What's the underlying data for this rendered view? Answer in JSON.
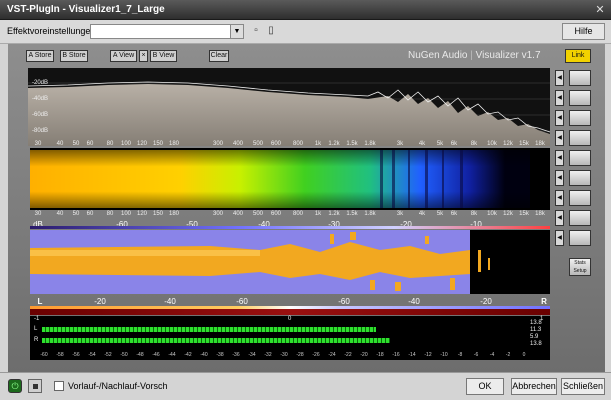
{
  "window": {
    "title": "VST-PlugIn - Visualizer1_7_Large",
    "close_symbol": "✕"
  },
  "presetbar": {
    "label": "Effektvoreinstellungen:",
    "preset_value": "",
    "help_label": "Hilfe"
  },
  "plugin": {
    "buttons": {
      "a_store": "A Store",
      "b_store": "B Store",
      "a_view": "A View",
      "x": "×",
      "b_view": "B View",
      "clear": "Clear",
      "link": "Link"
    },
    "brand": {
      "company": "NuGen Audio",
      "separator": "|",
      "product": "Visualizer v1.7"
    },
    "spectrum": {
      "db_labels": [
        "-20dB",
        "-40dB",
        "-60dB",
        "-80dB"
      ],
      "freq_labels": [
        "30",
        "40",
        "50",
        "60",
        "80",
        "100",
        "120",
        "150",
        "180",
        "300",
        "400",
        "500",
        "600",
        "800",
        "1k",
        "1.2k",
        "1.5k",
        "1.8k",
        "3k",
        "4k",
        "5k",
        "6k",
        "8k",
        "10k",
        "12k",
        "15k",
        "18k"
      ]
    },
    "spectrogram": {
      "freq_labels": [
        "30",
        "40",
        "50",
        "60",
        "80",
        "100",
        "120",
        "150",
        "180",
        "300",
        "400",
        "500",
        "600",
        "800",
        "1k",
        "1.2k",
        "1.5k",
        "1.8k",
        "3k",
        "4k",
        "5k",
        "6k",
        "8k",
        "10k",
        "12k",
        "15k",
        "18k"
      ]
    },
    "stereo": {
      "db_row": [
        "dB",
        "-60",
        "-50",
        "-40",
        "-30",
        "-20",
        "-10"
      ],
      "lr_row": [
        "L",
        "-20",
        "-40",
        "-60",
        "-60",
        "-40",
        "-20",
        "R"
      ]
    },
    "meters": {
      "left_label": "L",
      "right_label": "R",
      "minus1": "-1",
      "zero": "0",
      "plus1": "1",
      "l_level": 0.71,
      "r_level": 0.74,
      "values": [
        "13.8",
        "11.3",
        "5.9",
        "13.8"
      ],
      "scale": [
        "-60",
        "-58",
        "-56",
        "-54",
        "-52",
        "-50",
        "-48",
        "-46",
        "-44",
        "-42",
        "-40",
        "-38",
        "-36",
        "-34",
        "-32",
        "-30",
        "-28",
        "-26",
        "-24",
        "-22",
        "-20",
        "-18",
        "-16",
        "-14",
        "-12",
        "-10",
        "-8",
        "-6",
        "-4",
        "-2",
        "0"
      ]
    },
    "side": {
      "arrow": "◀",
      "stats_label": "Stats Setup"
    }
  },
  "bottom": {
    "power_symbol": "⏻",
    "checkbox_label": "Vorlauf-/Nachlauf-Vorsch",
    "ok": "OK",
    "cancel": "Abbrechen",
    "close": "Schließen"
  }
}
